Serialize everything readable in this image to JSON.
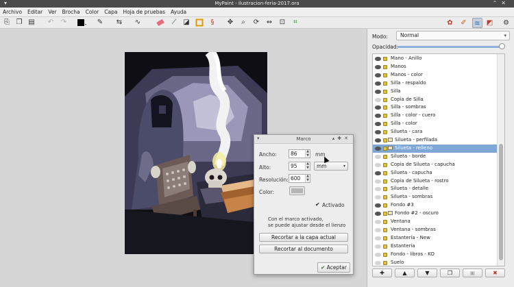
{
  "window": {
    "title": "MyPaint - ilustracion-feria-2017.ora",
    "controls_left": "▾",
    "controls_right": "⌃✕"
  },
  "menu": [
    "Archivo",
    "Editar",
    "Ver",
    "Brocha",
    "Color",
    "Capa",
    "Hoja de pruebas",
    "Ayuda"
  ],
  "toolbar_icons": [
    "new-document-icon",
    "open-document-icon",
    "save-document-icon",
    "undo-icon",
    "redo-icon",
    "color-swatch-icon",
    "brush-settings-icon",
    "symmetry-icon",
    "line-mode-icon",
    "eraser-icon",
    "color-picker-icon",
    "fill-icon",
    "frame-icon",
    "symmetry-edit-icon",
    "pan-icon",
    "zoom-icon",
    "rotate-icon",
    "mirror-icon",
    "reset-view-icon",
    "fit-view-icon"
  ],
  "right_toolbar": [
    "color-palette-icon",
    "brush-icon",
    "layers-icon",
    "scratchpad-icon",
    "settings-icon"
  ],
  "layer_panel": {
    "mode_label": "Modo:",
    "mode_value": "Normal",
    "opacity_label": "Opacidad:",
    "opacity": 1.0,
    "layers": [
      {
        "name": "Mano - Anillo",
        "visible": true,
        "group": false
      },
      {
        "name": "Manos",
        "visible": true,
        "group": false
      },
      {
        "name": "Manos - color",
        "visible": true,
        "group": false
      },
      {
        "name": "Silla - respaldo",
        "visible": true,
        "group": false
      },
      {
        "name": "Silla",
        "visible": true,
        "group": false
      },
      {
        "name": "Copia de Silla",
        "visible": false,
        "group": false
      },
      {
        "name": "Silla - sombras",
        "visible": true,
        "group": false
      },
      {
        "name": "Silla - color - cuero",
        "visible": true,
        "group": false
      },
      {
        "name": "Silla - color",
        "visible": true,
        "group": false
      },
      {
        "name": "Silueta - cara",
        "visible": true,
        "group": false
      },
      {
        "name": "Silueta - perfilada",
        "visible": true,
        "group": true
      },
      {
        "name": "Silueta - relleno",
        "visible": true,
        "group": true,
        "selected": true
      },
      {
        "name": "Silueta - borde",
        "visible": false,
        "group": false
      },
      {
        "name": "Copia de Silueta - capucha",
        "visible": false,
        "group": false
      },
      {
        "name": "Silueta - capucha",
        "visible": true,
        "group": false
      },
      {
        "name": "Copia de Silueta - rostro",
        "visible": false,
        "group": false
      },
      {
        "name": "Silueta - detalle",
        "visible": false,
        "group": false
      },
      {
        "name": "Silueta - sombras",
        "visible": false,
        "group": false
      },
      {
        "name": "Fondo #3",
        "visible": true,
        "group": false
      },
      {
        "name": "Fondo #2 - oscuro",
        "visible": true,
        "group": true
      },
      {
        "name": "Ventana",
        "visible": false,
        "group": false
      },
      {
        "name": "Ventana - sombras",
        "visible": false,
        "group": false
      },
      {
        "name": "Estantería - New",
        "visible": false,
        "group": false
      },
      {
        "name": "Estantería",
        "visible": false,
        "group": false
      },
      {
        "name": "Fondo - libros - KO",
        "visible": false,
        "group": false
      },
      {
        "name": "Suelo",
        "visible": false,
        "group": false
      }
    ],
    "buttons": [
      "add-layer-icon",
      "move-up-icon",
      "move-down-icon",
      "duplicate-layer-icon",
      "merge-layer-icon",
      "delete-layer-icon"
    ]
  },
  "frame_dialog": {
    "title": "Marco",
    "width_label": "Ancho:",
    "width_value": "86",
    "width_unit": "mm",
    "height_label": "Alto:",
    "height_value": "95",
    "unit_select": "mm",
    "resolution_label": "Resolución:",
    "resolution_value": "600",
    "color_label": "Color:",
    "enabled_label": "Activado",
    "enabled": true,
    "info_line1": "Con el marco activado,",
    "info_line2": "se puede ajustar desde el lienzo",
    "crop_layer_button": "Recortar a la capa actual",
    "crop_document_button": "Recortar al documento",
    "accept_button": "Aceptar"
  },
  "colors": {
    "selection": "#7fa7d6",
    "frame_color": "#b5b5b5",
    "current_color": "#000000"
  }
}
